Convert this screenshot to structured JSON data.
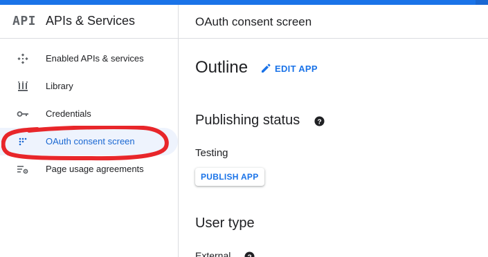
{
  "sidebar": {
    "logo_text": "API",
    "title": "APIs & Services",
    "items": [
      {
        "label": "Enabled APIs & services",
        "icon": "diamond-nodes-icon",
        "active": false
      },
      {
        "label": "Library",
        "icon": "library-icon",
        "active": false
      },
      {
        "label": "Credentials",
        "icon": "key-icon",
        "active": false
      },
      {
        "label": "OAuth consent screen",
        "icon": "consent-dots-icon",
        "active": true
      },
      {
        "label": "Page usage agreements",
        "icon": "settings-list-icon",
        "active": false
      }
    ]
  },
  "header": {
    "title": "OAuth consent screen"
  },
  "main": {
    "outline_title": "Outline",
    "edit_app_label": "EDIT APP",
    "publishing_status_title": "Publishing status",
    "status_value": "Testing",
    "publish_button_label": "PUBLISH APP",
    "user_type_title": "User type",
    "user_type_value": "External"
  },
  "colors": {
    "accent": "#1a73e8",
    "active_bg": "#eef3fd",
    "annotation_red": "#e8262a"
  }
}
